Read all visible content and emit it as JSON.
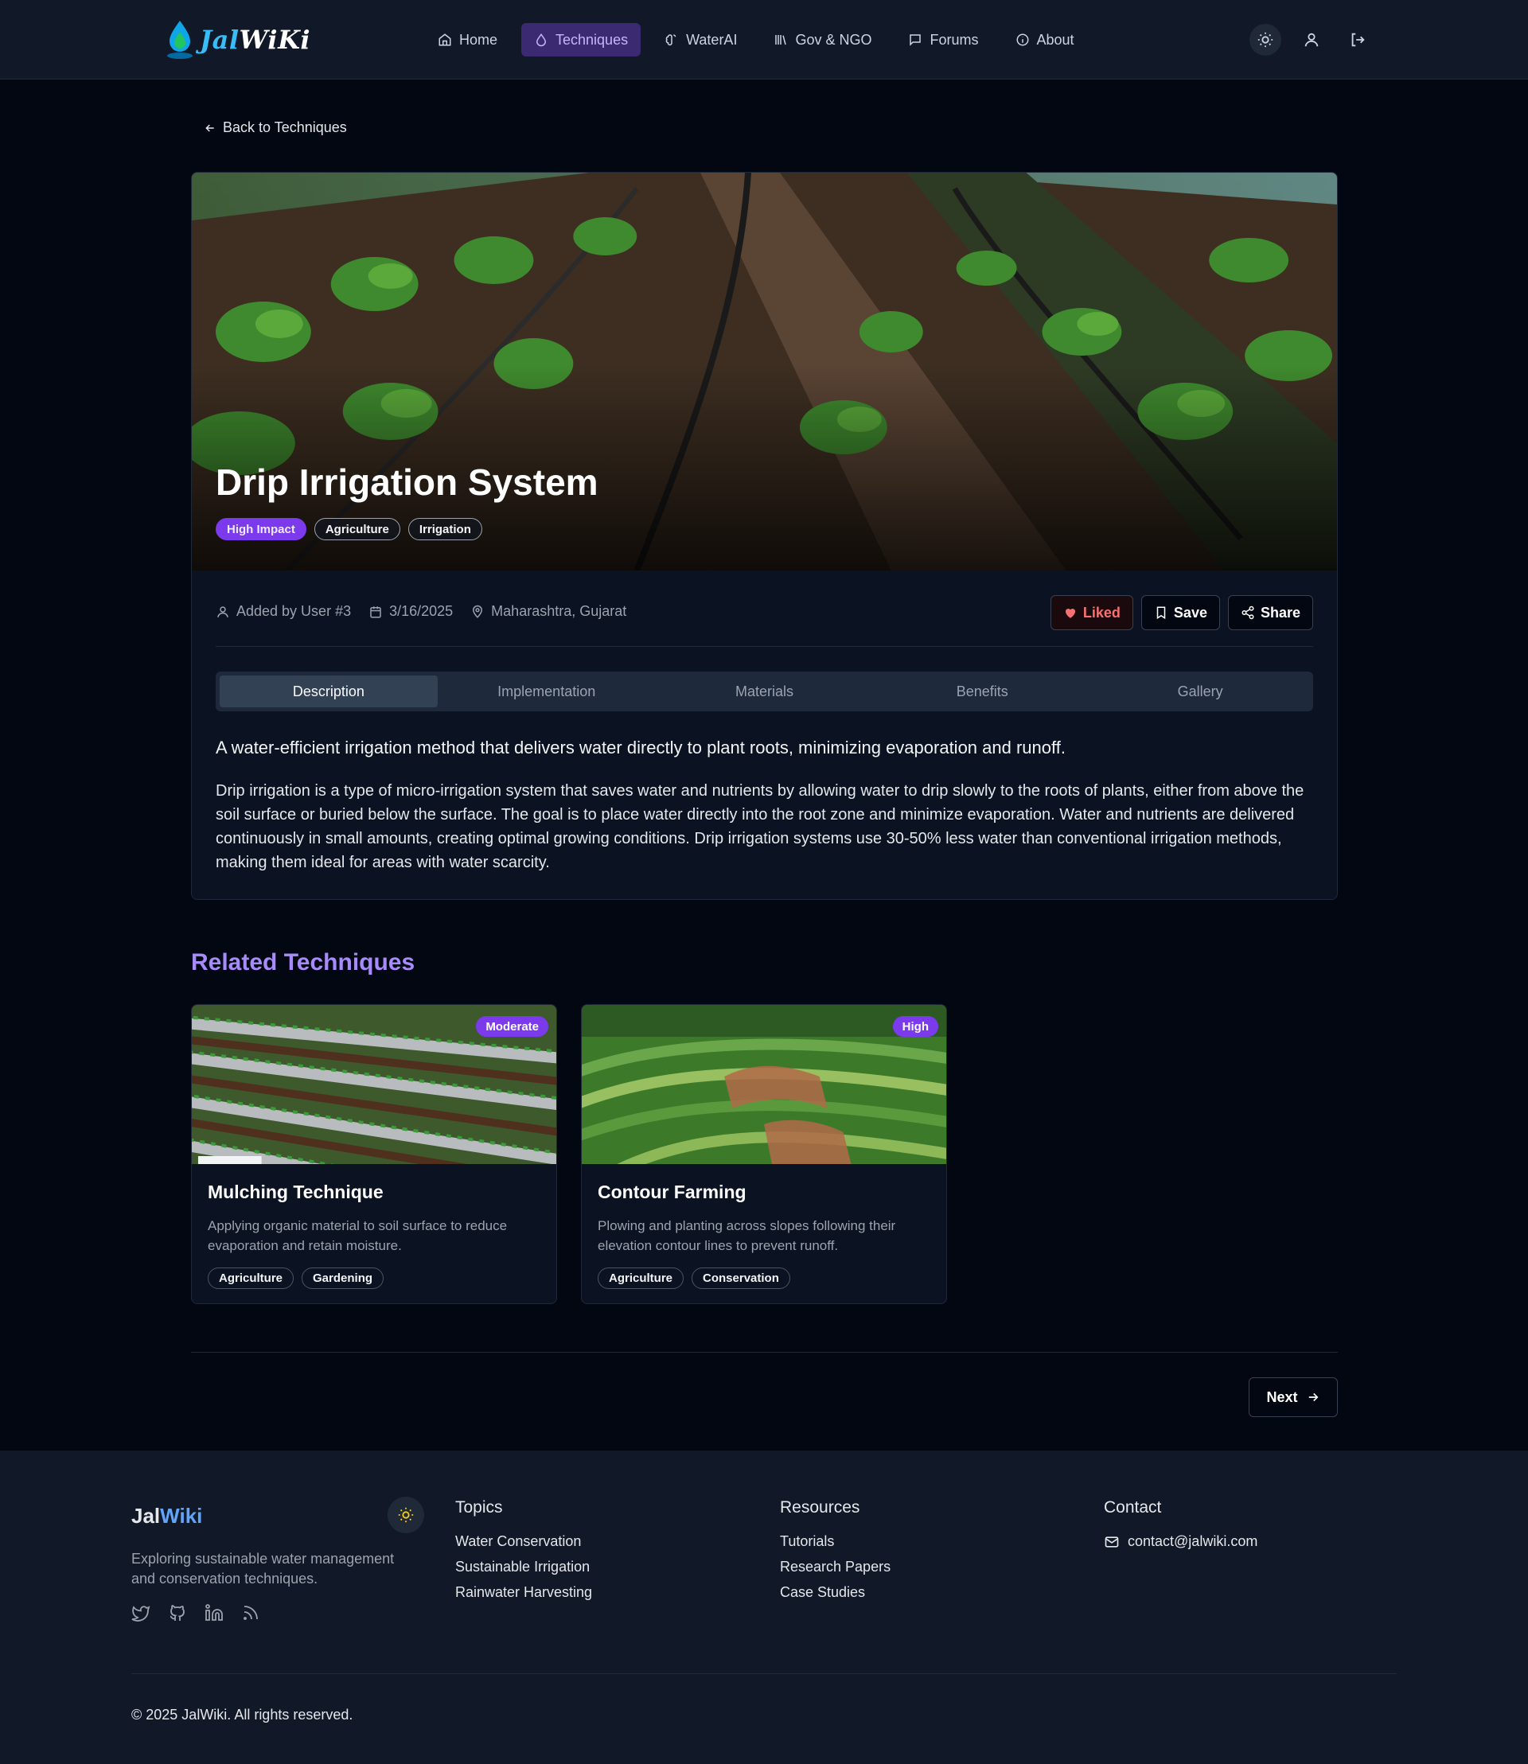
{
  "nav": {
    "logo_prefix": "Jal",
    "logo_suffix": "WiKi",
    "links": [
      {
        "label": "Home",
        "icon": "home-icon"
      },
      {
        "label": "Techniques",
        "icon": "droplet-icon",
        "active": true
      },
      {
        "label": "WaterAI",
        "icon": "brain-icon"
      },
      {
        "label": "Gov & NGO",
        "icon": "library-icon"
      },
      {
        "label": "Forums",
        "icon": "message-icon"
      },
      {
        "label": "About",
        "icon": "info-icon"
      }
    ],
    "accent": "#c4b5fd"
  },
  "back_label": "Back to Techniques",
  "technique": {
    "title": "Drip Irrigation System",
    "tags": [
      "High Impact",
      "Agriculture",
      "Irrigation"
    ],
    "author": "Added by User #3",
    "date": "3/16/2025",
    "location": "Maharashtra, Gujarat",
    "actions": {
      "like": "Liked",
      "save": "Save",
      "share": "Share"
    },
    "tabs": [
      "Description",
      "Implementation",
      "Materials",
      "Benefits",
      "Gallery"
    ],
    "active_tab": "Description",
    "lead": "A water-efficient irrigation method that delivers water directly to plant roots, minimizing evaporation and runoff.",
    "body": "Drip irrigation is a type of micro-irrigation system that saves water and nutrients by allowing water to drip slowly to the roots of plants, either from above the soil surface or buried below the surface. The goal is to place water directly into the root zone and minimize evaporation. Water and nutrients are delivered continuously in small amounts, creating optimal growing conditions. Drip irrigation systems use 30-50% less water than conventional irrigation methods, making them ideal for areas with water scarcity."
  },
  "related": {
    "title": "Related Techniques",
    "items": [
      {
        "title": "Mulching Technique",
        "badge": "Moderate",
        "description": "Applying organic material to soil surface to reduce evaporation and retain moisture.",
        "tags": [
          "Agriculture",
          "Gardening"
        ]
      },
      {
        "title": "Contour Farming",
        "badge": "High",
        "description": "Plowing and planting across slopes following their elevation contour lines to prevent runoff.",
        "tags": [
          "Agriculture",
          "Conservation"
        ]
      }
    ]
  },
  "next_label": "Next",
  "footer": {
    "logo_prefix": "Jal",
    "logo_suffix": "Wiki",
    "tagline": "Exploring sustainable water management and conservation techniques.",
    "topics": {
      "title": "Topics",
      "links": [
        "Water Conservation",
        "Sustainable Irrigation",
        "Rainwater Harvesting"
      ]
    },
    "resources": {
      "title": "Resources",
      "links": [
        "Tutorials",
        "Research Papers",
        "Case Studies"
      ]
    },
    "contact": {
      "title": "Contact",
      "email": "contact@jalwiki.com"
    },
    "copyright": "© 2025 JalWiki. All rights reserved."
  },
  "colors": {
    "background": "#030712",
    "purple": "#7c3aed",
    "related_title": "#a78bfa",
    "liked": "#f87171"
  }
}
